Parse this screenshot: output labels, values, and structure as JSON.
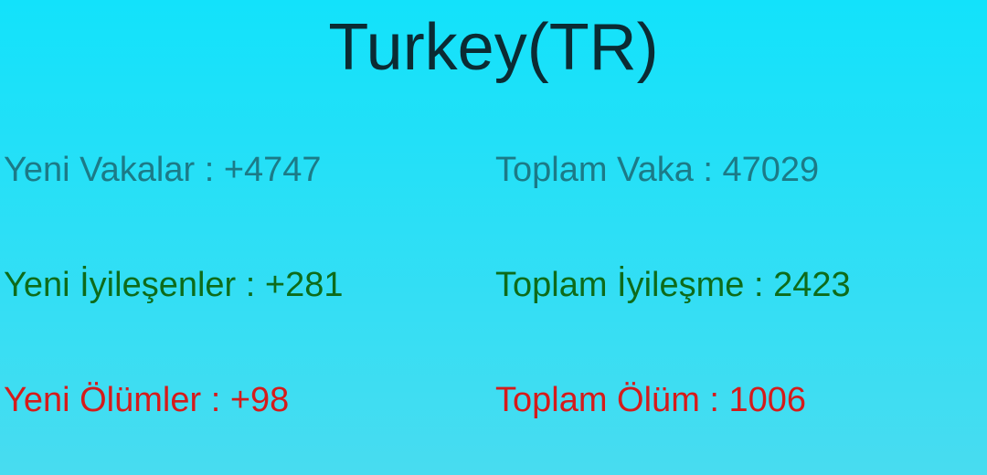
{
  "title": "Turkey(TR)",
  "colors": {
    "cases": "#1c7a87",
    "recovered": "#0e6b1a",
    "deaths": "#d51b1b",
    "title": "#0b2b33",
    "background_top": "#12e2fb",
    "background_bottom": "#48dcf0"
  },
  "stats": {
    "new_cases": "Yeni Vakalar : +4747",
    "total_cases": "Toplam Vaka : 47029",
    "new_recovered": "Yeni İyileşenler : +281",
    "total_recovered": "Toplam İyileşme : 2423",
    "new_deaths": "Yeni Ölümler : +98",
    "total_deaths": "Toplam Ölüm : 1006"
  }
}
